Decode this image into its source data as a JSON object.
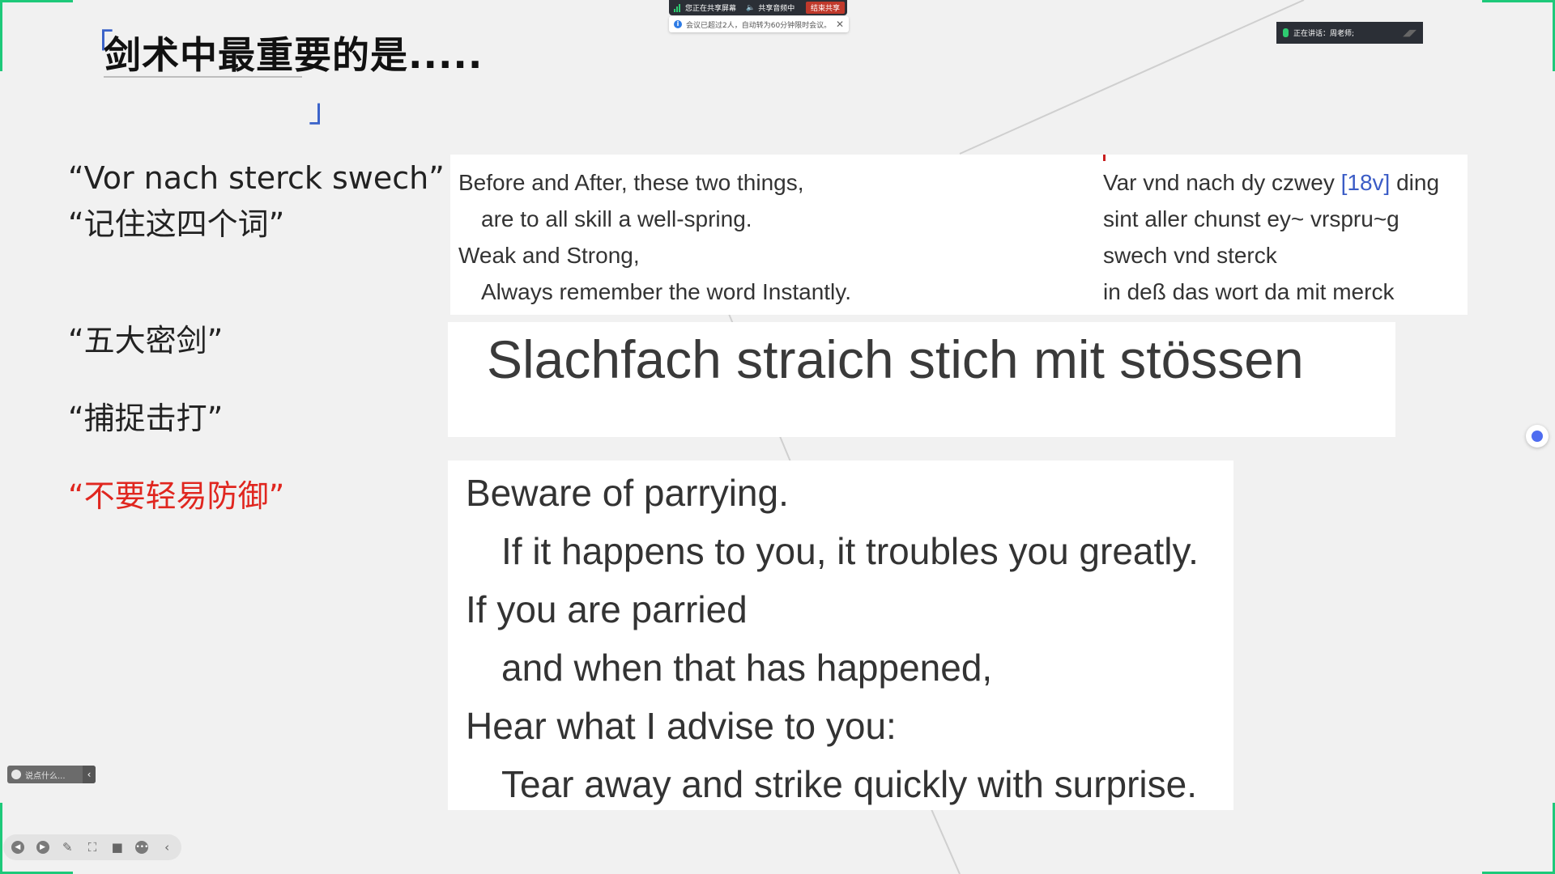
{
  "title": "剑术中最重要的是.....",
  "left_items": [
    {
      "text": "“Vor nach sterck swech”"
    },
    {
      "text": "“记住这四个词”"
    },
    {
      "text": "“五大密剑”"
    },
    {
      "text": "“捕捉击打”"
    },
    {
      "text": "“不要轻易防御”"
    }
  ],
  "panel1": {
    "left_lines": [
      "Before and After, these two things,",
      "are to all skill a well-spring.",
      "Weak and Strong,",
      "Always remember the word Instantly."
    ],
    "right_lines": [
      "Var vnd nach dy czwey",
      "[18v]",
      "ding",
      "sint aller chunst ey~ vrspru~g",
      "swech vnd sterck",
      "in deß das wort da mit merck"
    ]
  },
  "panel2": {
    "text": "Slachfach straich stich mit stössen"
  },
  "panel3": {
    "lines": [
      "Beware of parrying.",
      "If it happens to you, it troubles you greatly.",
      "If you are parried",
      "and when that has happened,",
      "Hear what I advise to you:",
      "Tear away and strike quickly with surprise."
    ]
  },
  "share_bar": {
    "sharing_label": "您正在共享屏幕",
    "audio_label": "共享音频中",
    "end_label": "结束共享"
  },
  "notice": {
    "text": "会议已超过2人，自动转为60分钟限时会议。"
  },
  "speaking": {
    "label": "正在讲话：周老师;"
  },
  "chat_pill": {
    "placeholder": "说点什么..."
  },
  "colors": {
    "accent_green": "#1ec97a",
    "bracket_blue": "#3a62c9",
    "highlight_red": "#e0261f",
    "background": "#f1f1f1"
  }
}
